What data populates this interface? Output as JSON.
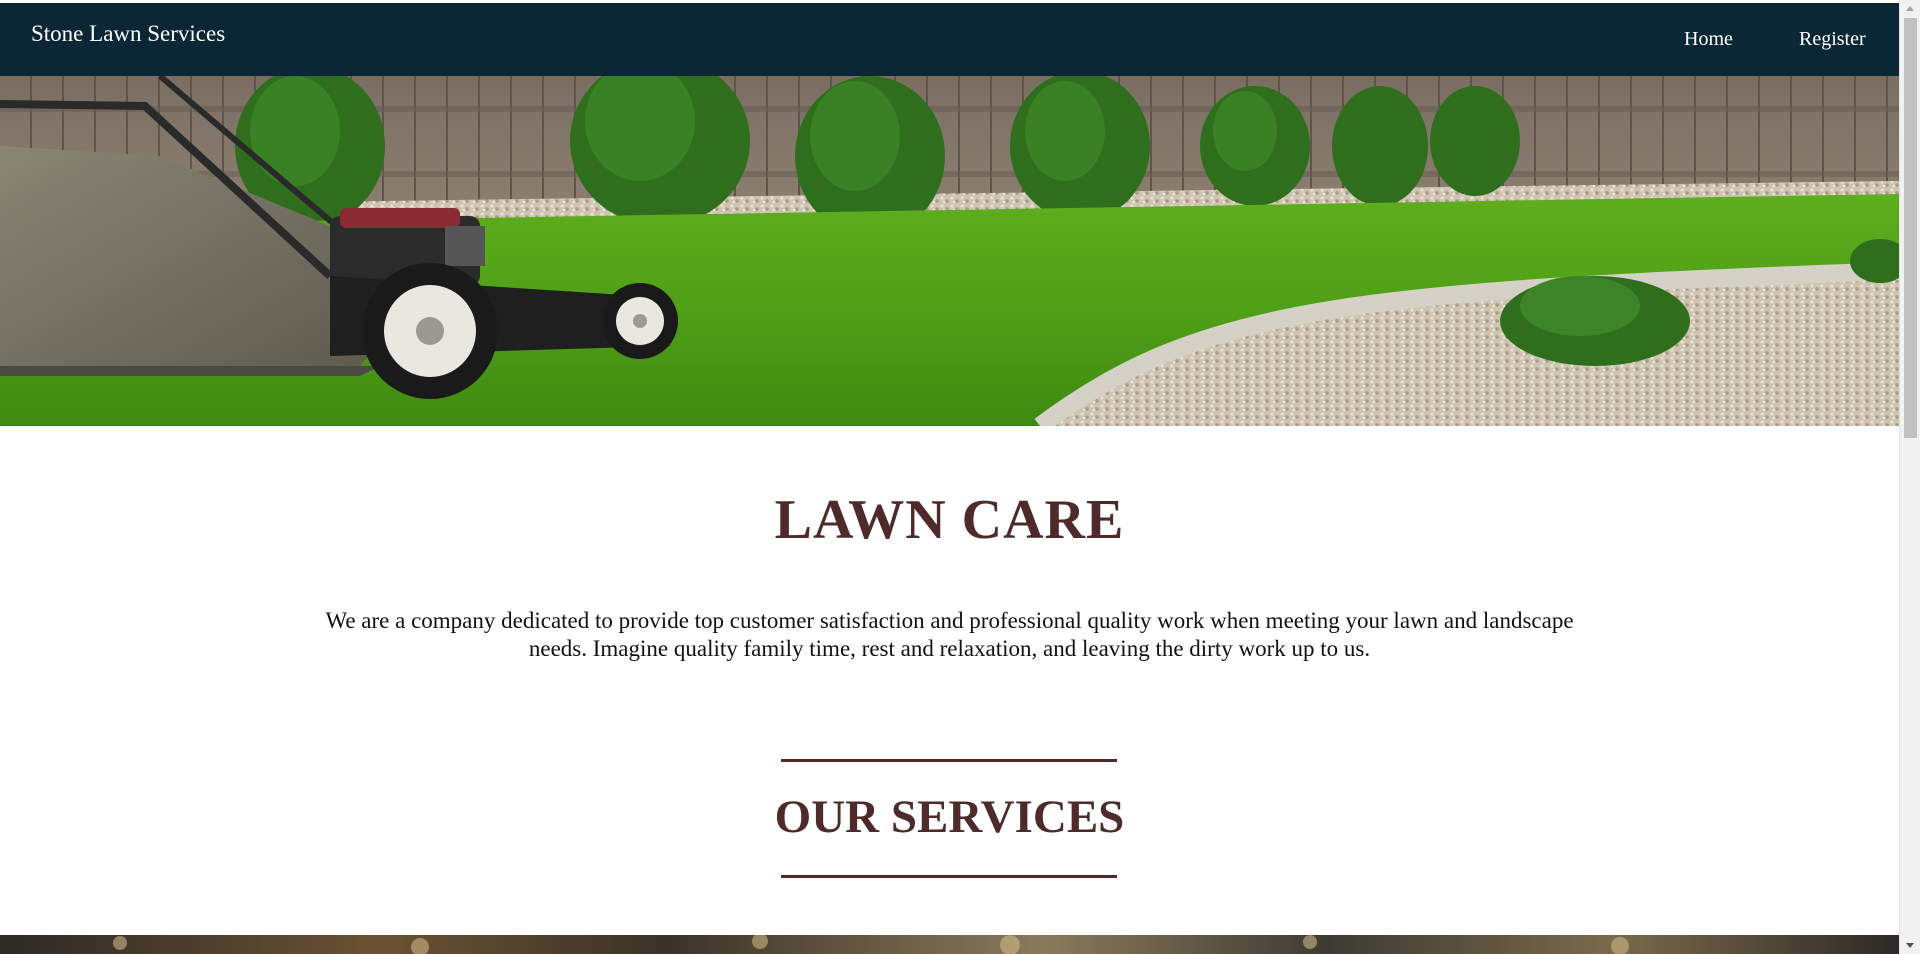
{
  "nav": {
    "brand": "Stone Lawn Services",
    "links": [
      {
        "label": "Home"
      },
      {
        "label": "Register"
      }
    ]
  },
  "hero": {
    "image": "lawn-mower-on-green-grass-with-fence-and-shrubs"
  },
  "main": {
    "title": "LAWN CARE",
    "intro": "We are a company dedicated to provide top customer satisfaction and professional quality work when meeting your lawn and landscape needs. Imagine quality family time, rest and relaxation, and leaving the dirty work up to us."
  },
  "services": {
    "title": "OUR SERVICES"
  },
  "colors": {
    "navbar": "#0b2735",
    "heading": "#4f2a2a",
    "text": "#111111"
  }
}
